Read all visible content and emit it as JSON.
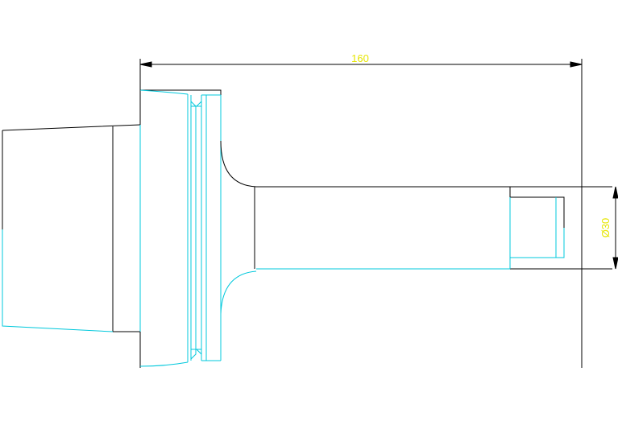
{
  "drawing": {
    "colors": {
      "background": "#ffffff",
      "outline": "#000000",
      "detail": "#00c8dc",
      "dimension_text": "#e6e600"
    },
    "dimensions": {
      "overall_length": "160",
      "shank_diameter": "Ø30"
    }
  }
}
